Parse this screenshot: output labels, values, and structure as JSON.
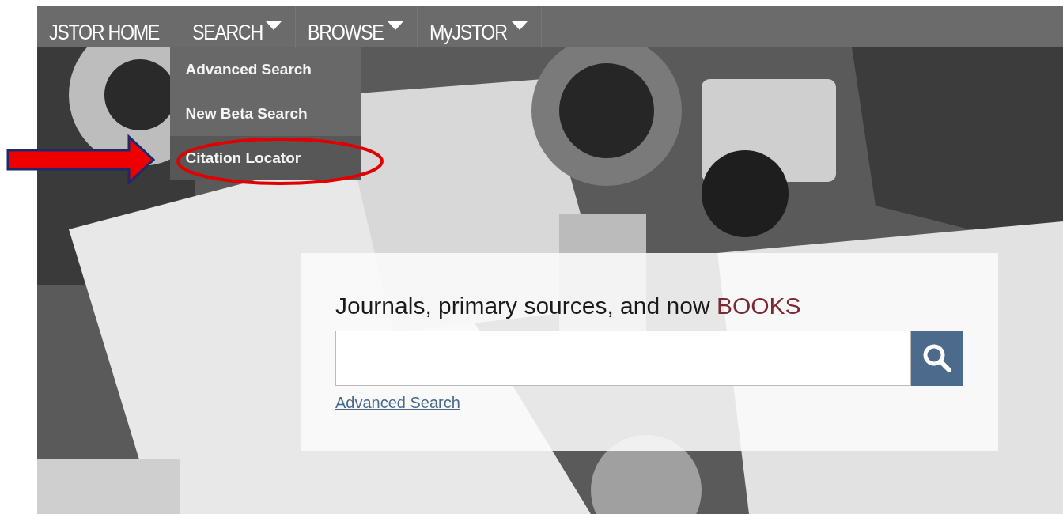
{
  "nav": {
    "items": [
      {
        "label": "JSTOR HOME",
        "has_menu": false,
        "expanded": false
      },
      {
        "label": "SEARCH",
        "has_menu": true,
        "expanded": true
      },
      {
        "label": "BROWSE",
        "has_menu": true,
        "expanded": false
      },
      {
        "label": "MyJSTOR",
        "has_menu": true,
        "expanded": false
      }
    ]
  },
  "dropdown": {
    "items": [
      {
        "label": "Advanced Search",
        "selected": false
      },
      {
        "label": "New Beta Search",
        "selected": false
      },
      {
        "label": "Citation Locator",
        "selected": true
      }
    ]
  },
  "search_panel": {
    "headline": "Journals, primary sources, and now",
    "headline_highlight": "BOOKS",
    "link": "Advanced Search"
  }
}
